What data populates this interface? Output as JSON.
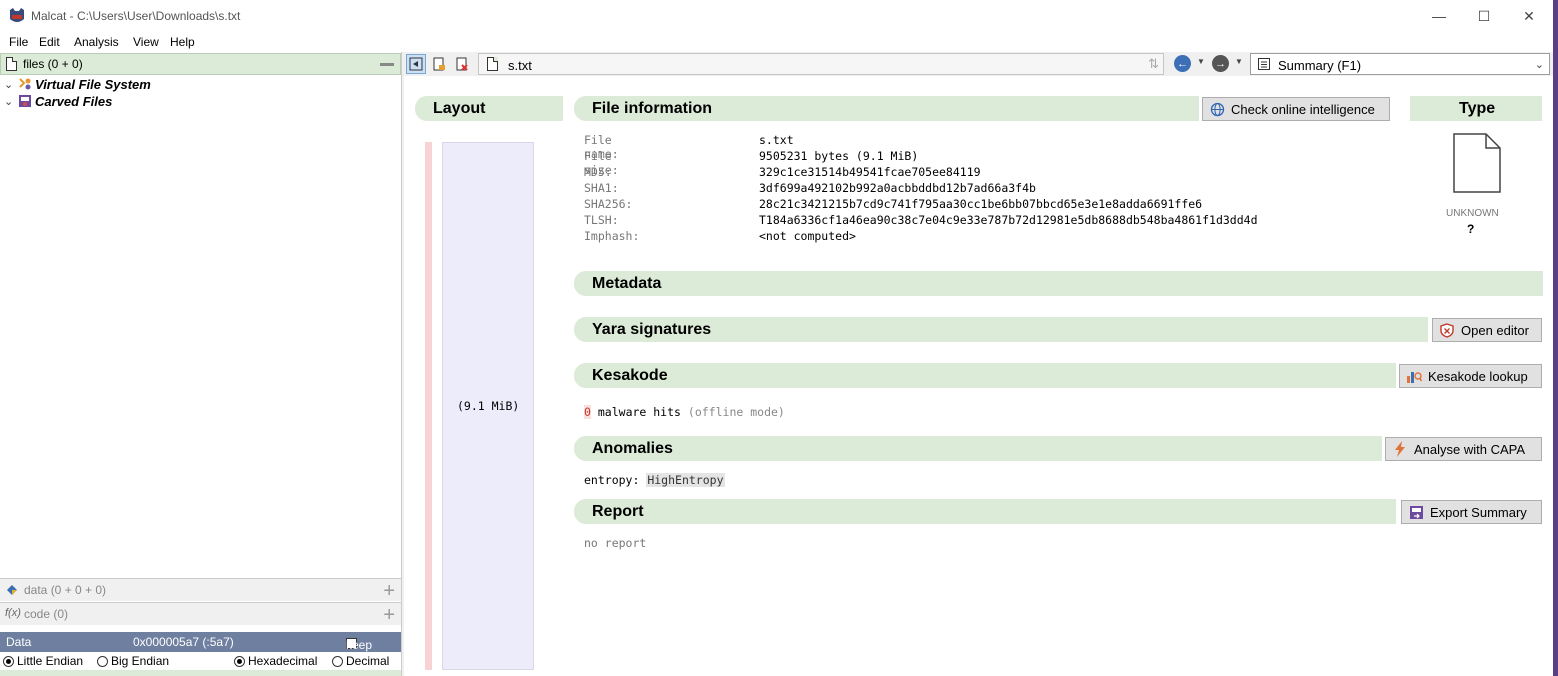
{
  "window": {
    "title": "Malcat - C:\\Users\\User\\Downloads\\s.txt",
    "controls": [
      "minimize",
      "maximize",
      "close"
    ]
  },
  "menu": [
    "File",
    "Edit",
    "Analysis",
    "View",
    "Help"
  ],
  "left_panel": {
    "files_header": "files (0 + 0)",
    "tree": [
      {
        "label": "Virtual File System",
        "icon": "vfs-icon"
      },
      {
        "label": "Carved Files",
        "icon": "carved-files-icon"
      }
    ],
    "data_section": "data (0 + 0 + 0)",
    "code_section": "code (0)",
    "data_bar": {
      "label": "Data",
      "offset": "0x000005a7 (:5a7)",
      "keep": "keep"
    },
    "endian": {
      "little": "Little Endian",
      "big": "Big Endian",
      "hex": "Hexadecimal",
      "dec": "Decimal"
    }
  },
  "toolbar": {
    "path": "s.txt",
    "view_selector": "Summary     (F1)"
  },
  "summary": {
    "layout_title": "Layout",
    "layout_size": "(9.1 MiB)",
    "file_info_title": "File information",
    "check_online_label": "Check online intelligence",
    "type_title": "Type",
    "type_name": "UNKNOWN",
    "type_value": "?",
    "file_info": [
      {
        "key": "File name:",
        "value": "s.txt"
      },
      {
        "key": "File size:",
        "value": "9505231 bytes (9.1 MiB)"
      },
      {
        "key": "MD5:",
        "value": "329c1ce31514b49541fcae705ee84119"
      },
      {
        "key": "SHA1:",
        "value": "3df699a492102b992a0acbbddbd12b7ad66a3f4b"
      },
      {
        "key": "SHA256:",
        "value": "28c21c3421215b7cd9c741f795aa30cc1be6bb07bbcd65e3e1e8adda6691ffe6"
      },
      {
        "key": "TLSH:",
        "value": "T184a6336cf1a46ea90c38c7e04c9e33e787b72d12981e5db8688db548ba4861f1d3dd4d"
      },
      {
        "key": "Imphash:",
        "value": "<not computed>"
      }
    ],
    "metadata_title": "Metadata",
    "yara_title": "Yara signatures",
    "open_editor_label": "Open editor",
    "kesakode_title": "Kesakode",
    "kesakode_lookup_label": "Kesakode lookup",
    "kesakode_count": "0",
    "kesakode_text": "malware hits",
    "kesakode_mode": "(offline mode)",
    "anomalies_title": "Anomalies",
    "capa_label": "Analyse with CAPA",
    "anomaly_key": "entropy:",
    "anomaly_value": "HighEntropy",
    "report_title": "Report",
    "export_label": "Export Summary",
    "report_text": "no report"
  },
  "colors": {
    "section_bg": "#dcebd7",
    "databar_bg": "#6f7fa0",
    "accent_red": "#d9534f"
  }
}
